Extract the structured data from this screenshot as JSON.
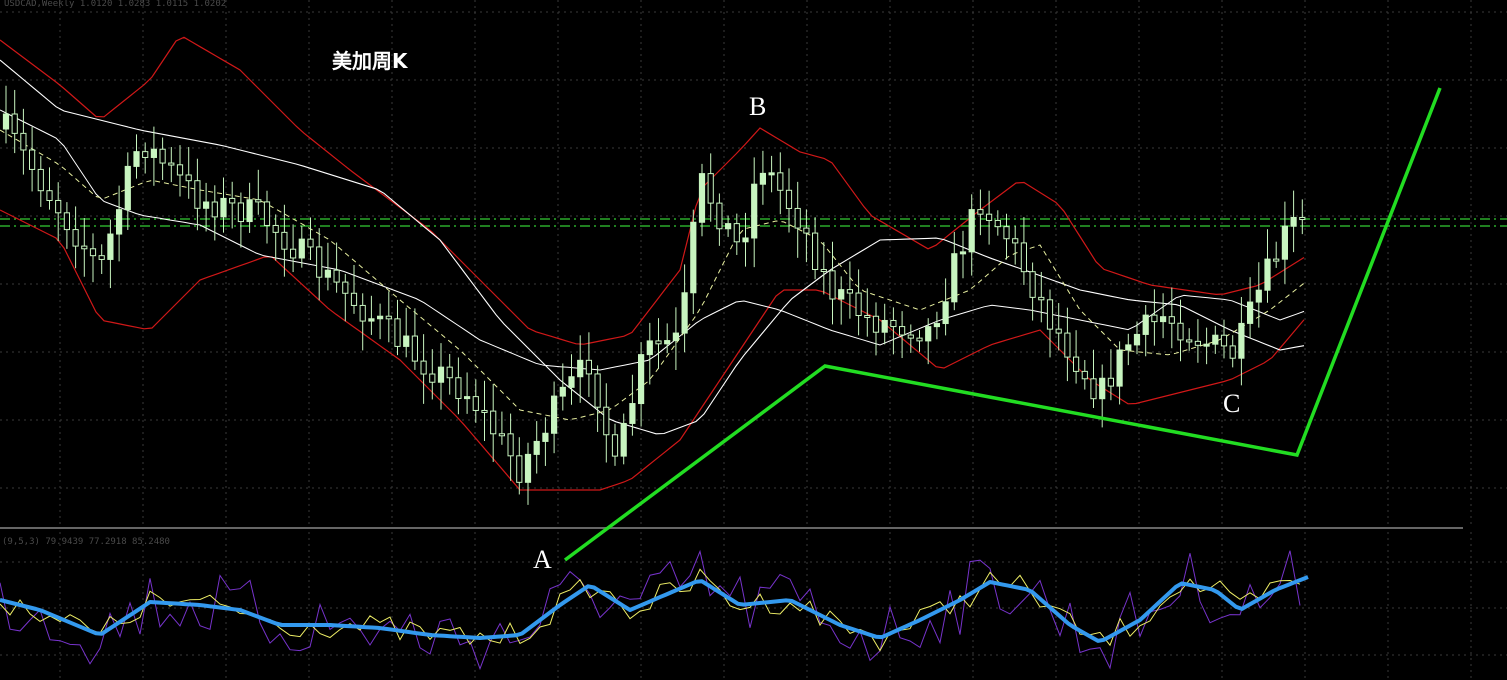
{
  "title": "美加周K",
  "main_header": "USDCAD,Weekly  1.0120 1.0283 1.0115 1.0202",
  "sub_header": "(9,5,3) 79.9439 77.2918 85.2480",
  "labels": {
    "a": "A",
    "b": "B",
    "c": "C"
  },
  "colors": {
    "background": "#000000",
    "grid": "#3a3a3a",
    "candle": "#c8f5c0",
    "bb_outer": "#d01818",
    "bb_inner": "#ffffff",
    "bb_mid": "#e8f0a0",
    "hline": "#33cc33",
    "pattern": "#22dd22",
    "kdj_k": "#7733cc",
    "kdj_d": "#eeee66",
    "kdj_smooth": "#3399ee",
    "label": "#ffffff"
  },
  "chart_data": [
    {
      "type": "candlestick",
      "title": "美加周K",
      "series": [
        {
          "name": "candles",
          "note": "~150 weekly candles: decline from upper-left to low A, rally to peak B, consolidation lower to C, recovery at right edge"
        },
        {
          "name": "bollinger-upper"
        },
        {
          "name": "bollinger-lower"
        },
        {
          "name": "moving-average"
        },
        {
          "name": "dashed-mid-band"
        }
      ],
      "horizontal_lines": 2,
      "pattern_points": [
        "A",
        "B",
        "C"
      ],
      "grid": true
    },
    {
      "type": "line",
      "title": "(9,5,3)",
      "values_shown": [
        79.9439,
        77.2918,
        85.248
      ],
      "series": [
        {
          "name": "K"
        },
        {
          "name": "D"
        },
        {
          "name": "smoothed"
        }
      ],
      "grid": true
    }
  ]
}
